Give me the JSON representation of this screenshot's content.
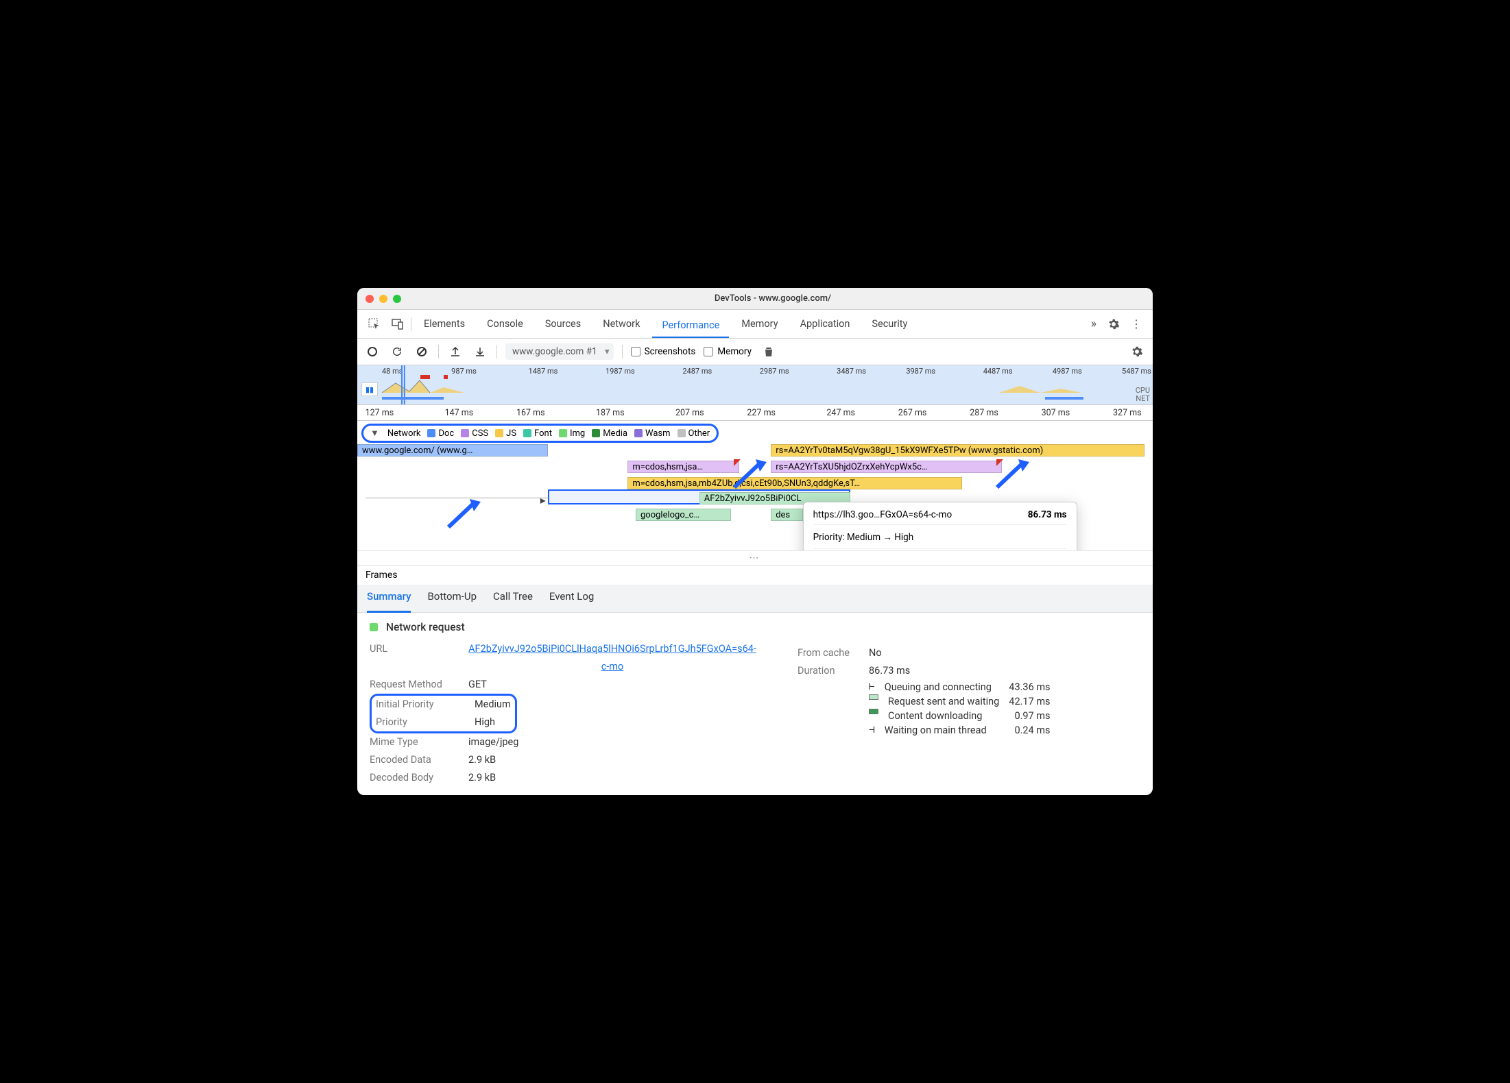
{
  "window_title": "DevTools - www.google.com/",
  "tabs": [
    "Elements",
    "Console",
    "Sources",
    "Network",
    "Performance",
    "Memory",
    "Application",
    "Security"
  ],
  "active_tab": "Performance",
  "toolbar": {
    "record_select": "www.google.com #1",
    "screenshots_label": "Screenshots",
    "memory_label": "Memory"
  },
  "overview_ticks": [
    "48 ms",
    "987 ms",
    "1487 ms",
    "1987 ms",
    "2487 ms",
    "2987 ms",
    "3487 ms",
    "3987 ms",
    "4487 ms",
    "4987 ms",
    "5487 ms"
  ],
  "overview_labels": [
    "CPU",
    "NET"
  ],
  "ruler_ticks": [
    "127 ms",
    "147 ms",
    "167 ms",
    "187 ms",
    "207 ms",
    "227 ms",
    "247 ms",
    "267 ms",
    "287 ms",
    "307 ms",
    "327 ms"
  ],
  "legend": {
    "section": "Network",
    "items": [
      "Doc",
      "CSS",
      "JS",
      "Font",
      "Img",
      "Media",
      "Wasm",
      "Other"
    ]
  },
  "requests": {
    "r1": "www.google.com/ (www.g…",
    "r2": "rs=AA2YrTv0taM5qVgw38gU_15kX9WFXe5TPw (www.gstatic.com)",
    "r3": "m=cdos,hsm,jsa…",
    "r4": "rs=AA2YrTsXU5hjdOZrxXehYcpWx5c…",
    "r5": "m=cdos,hsm,jsa,mb4ZUb,d,csi,cEt90b,SNUn3,qddgKe,sT…",
    "r6": "AF2bZyivvJ92o5BiPi0CL",
    "r7": "googlelogo_c…",
    "r8": "des"
  },
  "tooltip": {
    "url": "https://lh3.goo…FGxOA=s64-c-mo",
    "total": "86.73 ms",
    "priority_line": "Priority: Medium → High",
    "rows": [
      {
        "label": "Queuing and connecting",
        "val": "43.36 ms",
        "icon": "hbar"
      },
      {
        "label": "Request sent and waiting",
        "val": "42.17 ms",
        "icon": "box-green"
      },
      {
        "label": "Content downloading",
        "val": "0.97 ms",
        "icon": "box-dark"
      },
      {
        "label": "Waiting on main thread",
        "val": "0.24 ms",
        "icon": "tbar"
      }
    ]
  },
  "frames_label": "Frames",
  "subtabs": [
    "Summary",
    "Bottom-Up",
    "Call Tree",
    "Event Log"
  ],
  "summary": {
    "heading": "Network request",
    "url_label": "URL",
    "url_value": "AF2bZyivvJ92o5BiPi0CLlHaqa5lHNOi6SrpLrbf1GJh5FGxOA=s64-c-mo",
    "method_label": "Request Method",
    "method_value": "GET",
    "initprio_label": "Initial Priority",
    "initprio_value": "Medium",
    "prio_label": "Priority",
    "prio_value": "High",
    "mime_label": "Mime Type",
    "mime_value": "image/jpeg",
    "enc_label": "Encoded Data",
    "enc_value": "2.9 kB",
    "dec_label": "Decoded Body",
    "dec_value": "2.9 kB",
    "cache_label": "From cache",
    "cache_value": "No",
    "dur_label": "Duration",
    "dur_value": "86.73 ms",
    "timing": [
      {
        "label": "Queuing and connecting",
        "val": "43.36 ms"
      },
      {
        "label": "Request sent and waiting",
        "val": "42.17 ms"
      },
      {
        "label": "Content downloading",
        "val": "0.97 ms"
      },
      {
        "label": "Waiting on main thread",
        "val": "0.24 ms"
      }
    ]
  }
}
